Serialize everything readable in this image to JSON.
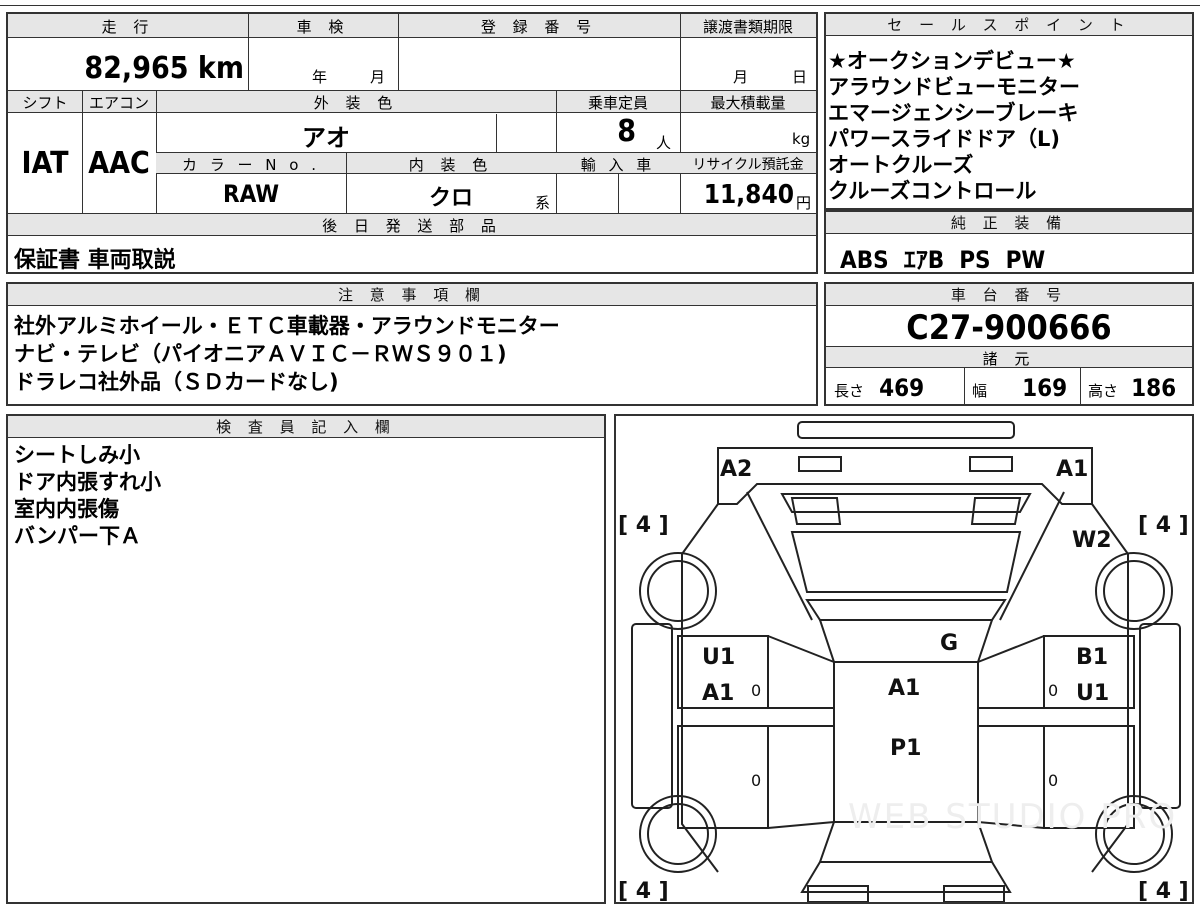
{
  "top_left": {
    "mileage": {
      "label": "走 行",
      "value": "82,965",
      "unit": "km"
    },
    "inspection": {
      "label": "車 検",
      "year_unit": "年",
      "month_unit": "月"
    },
    "registration": {
      "label": "登 録 番 号",
      "value": ""
    },
    "transfer_deadline": {
      "label": "譲渡書類期限",
      "month_unit": "月",
      "day_unit": "日"
    },
    "shift": {
      "label": "シフト",
      "value": "IAT"
    },
    "aircon": {
      "label": "エアコン",
      "value": "AAC"
    },
    "exterior_color": {
      "label": "外 装 色",
      "value": "アオ"
    },
    "capacity": {
      "label": "乗車定員",
      "value": "8",
      "unit": "人"
    },
    "max_load": {
      "label": "最大積載量",
      "value": "",
      "unit": "kg"
    },
    "color_no": {
      "label": "カ ラ ー N o .",
      "value": "RAW"
    },
    "interior_color": {
      "label": "内 装 色",
      "value": "クロ",
      "suffix": "系"
    },
    "import": {
      "label": "輸 入 車",
      "value": ""
    },
    "recycle_fee": {
      "label": "リサイクル預託金",
      "value": "11,840",
      "unit": "円"
    },
    "later_parts": {
      "label": "後 日 発 送 部 品",
      "value": "保証書 車両取説"
    }
  },
  "sales_points": {
    "label": "セ ー ル ス ポ イ ン ト",
    "items": [
      "★オークションデビュー★",
      "アラウンドビューモニター",
      "エマージェンシーブレーキ",
      "パワースライドドア（L)",
      "オートクルーズ",
      "クルーズコントロール"
    ]
  },
  "genuine_equipment": {
    "label": "純 正 装 備",
    "value": "ABS  ｴｱB  PS  PW"
  },
  "notes": {
    "label": "注 意 事 項 欄",
    "lines": [
      "社外アルミホイール・ＥＴＣ車載器・アラウンドモニター",
      "ナビ・テレビ（パイオニアＡＶＩＣ－ＲＷＳ９０１)",
      "ドラレコ社外品（ＳＤカードなし)"
    ]
  },
  "chassis": {
    "label": "車 台 番 号",
    "value": "C27-900666"
  },
  "specs": {
    "label": "諸 元",
    "length": {
      "label": "長さ",
      "value": "469"
    },
    "width": {
      "label": "幅",
      "value": "169"
    },
    "height": {
      "label": "高さ",
      "value": "186"
    }
  },
  "inspector": {
    "label": "検 査 員 記 入 欄",
    "lines": [
      "シートしみ小",
      "ドア内張すれ小",
      "室内内張傷",
      "バンパー下Ａ"
    ]
  },
  "diagram": {
    "tire_front_left": "[ 4 ]",
    "tire_front_right": "[ 4 ]",
    "tire_rear_left": "[ 4 ]",
    "tire_rear_right": "[ 4 ]",
    "marks": {
      "front_bumper_left": "A2",
      "front_bumper_right": "A1",
      "windshield": "W2",
      "roof_front": "G",
      "left_front_door_1": "U1",
      "left_front_door_2": "A1",
      "right_front_door_1": "B1",
      "right_front_door_2": "U1",
      "roof_center": "A1",
      "roof_rear": "P1",
      "small_zero": "0"
    },
    "watermark": "WEB STUDIO PRO"
  }
}
